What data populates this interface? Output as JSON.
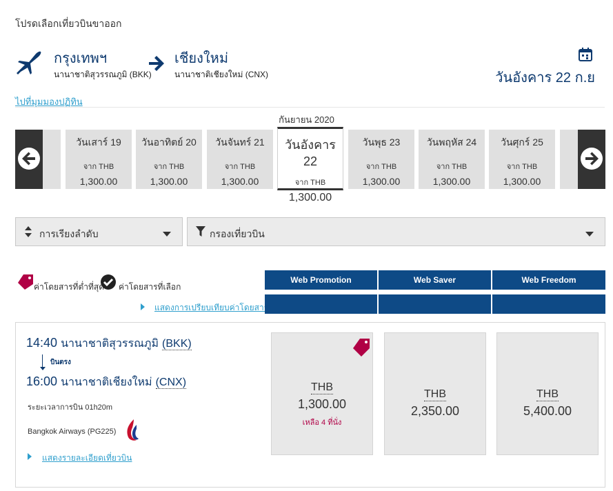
{
  "page": {
    "title": "โปรดเลือกเที่ยวบินขาออก"
  },
  "route": {
    "origin_city": "กรุงเทพฯ",
    "origin_airport": "นานาชาติสุวรรณภูมิ (BKK)",
    "dest_city": "เชียงใหม่",
    "dest_airport": "นานาชาติเชียงใหม่ (CNX)",
    "selected_date": "วันอังคาร 22 ก.ย",
    "calendar_link": "ไปที่มุมมองปฏิทิน"
  },
  "calendar": {
    "month": "กันยายน 2020",
    "days": [
      {
        "label": "วันเสาร์ 19",
        "from": "จาก THB",
        "price": "1,300.00"
      },
      {
        "label": "วันอาทิตย์ 20",
        "from": "จาก THB",
        "price": "1,300.00"
      },
      {
        "label": "วันจันทร์ 21",
        "from": "จาก THB",
        "price": "1,300.00"
      },
      {
        "label": "วันอังคาร 22",
        "from": "จาก THB",
        "price": "1,300.00"
      },
      {
        "label": "วันพุธ 23",
        "from": "จาก THB",
        "price": "1,300.00"
      },
      {
        "label": "วันพฤหัส 24",
        "from": "จาก THB",
        "price": "1,300.00"
      },
      {
        "label": "วันศุกร์ 25",
        "from": "จาก THB",
        "price": "1,300.00"
      }
    ]
  },
  "controls": {
    "sort_label": "การเรียงลำดับ",
    "filter_label": "กรองเที่ยวบิน"
  },
  "legend": {
    "lowest": "ค่าโดยสารที่ต่ำที่สุด",
    "selected": "ค่าโดยสารที่เลือก",
    "compare_link": "แสดงการเปรียบเทียบค่าโดยสาร"
  },
  "fare_families": [
    "Web Promotion",
    "Web Saver",
    "Web Freedom"
  ],
  "flight": {
    "depart_time": "14:40",
    "depart_airport_name": "นานาชาติสุวรรณภูมิ",
    "depart_code": "(BKK)",
    "nonstop": "บินตรง",
    "arrive_time": "16:00",
    "arrive_airport_name": "นานาชาติเชียงใหม่",
    "arrive_code": "(CNX)",
    "duration": "ระยะเวลาการบิน 01h20m",
    "airline": "Bangkok Airways (PG225)",
    "details_link": "แสดงรายละเอียดเที่ยวบิน",
    "fares": [
      {
        "currency": "THB",
        "amount": "1,300.00",
        "seats_left": "เหลือ 4 ที่นั่ง"
      },
      {
        "currency": "THB",
        "amount": "2,350.00"
      },
      {
        "currency": "THB",
        "amount": "5,400.00"
      }
    ]
  },
  "colors": {
    "brand": "#0e3a6f",
    "header_band": "#0e4a86",
    "link": "#2f9fcd",
    "tag": "#b00045"
  }
}
